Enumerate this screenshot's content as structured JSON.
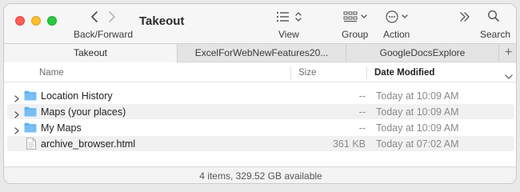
{
  "toolbar": {
    "nav_label": "Back/Forward",
    "title": "Takeout",
    "view_label": "View",
    "group_label": "Group",
    "action_label": "Action",
    "search_label": "Search"
  },
  "tabs": [
    {
      "label": "Takeout",
      "active": true
    },
    {
      "label": "ExcelForWebNewFeatures20...",
      "active": false
    },
    {
      "label": "GoogleDocsExplore",
      "active": false
    }
  ],
  "columns": {
    "name": "Name",
    "size": "Size",
    "date": "Date Modified"
  },
  "rows": [
    {
      "name": "Location History",
      "size": "--",
      "date": "Today at 10:09 AM",
      "kind": "folder"
    },
    {
      "name": "Maps (your places)",
      "size": "--",
      "date": "Today at 10:09 AM",
      "kind": "folder"
    },
    {
      "name": "My Maps",
      "size": "--",
      "date": "Today at 10:09 AM",
      "kind": "folder"
    },
    {
      "name": "archive_browser.html",
      "size": "361 KB",
      "date": "Today at 07:02 AM",
      "kind": "file"
    }
  ],
  "status": {
    "text": "4 items, 329.52 GB available"
  },
  "colors": {
    "folder": "#5aaef0",
    "close": "#fe5f57",
    "minimize": "#febc2e",
    "zoom": "#28c840"
  }
}
